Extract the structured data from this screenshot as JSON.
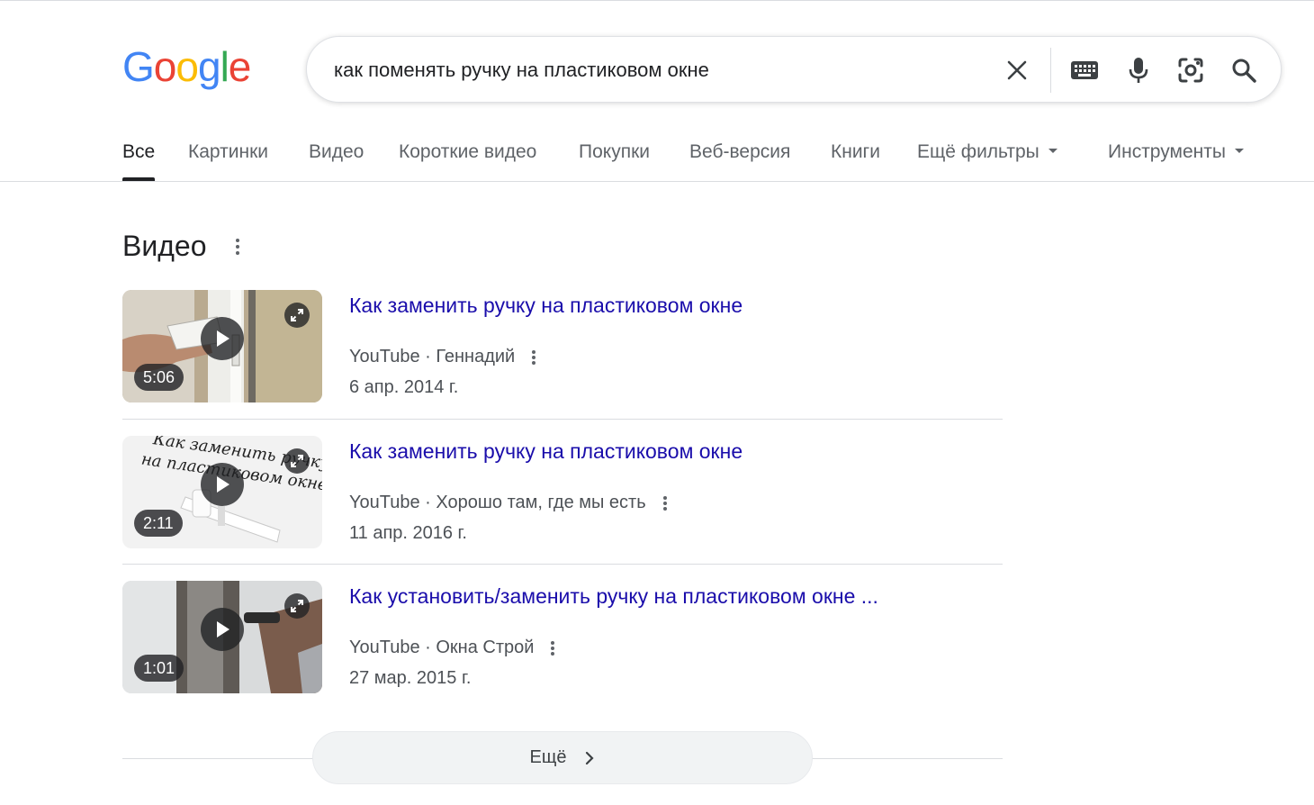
{
  "logo": {
    "text": "Google"
  },
  "search": {
    "query": "как поменять ручку на пластиковом окне"
  },
  "tabs": [
    {
      "label": "Все"
    },
    {
      "label": "Картинки"
    },
    {
      "label": "Видео"
    },
    {
      "label": "Короткие видео"
    },
    {
      "label": "Покупки"
    },
    {
      "label": "Веб-версия"
    },
    {
      "label": "Книги"
    },
    {
      "label": "Ещё фильтры"
    },
    {
      "label": "Инструменты"
    }
  ],
  "videos_section": {
    "title": "Видео",
    "items": [
      {
        "title": "Как заменить ручку на пластиковом окне",
        "source": "YouTube",
        "author": "Геннадий",
        "date": "6 апр. 2014 г.",
        "duration": "5:06"
      },
      {
        "title": "Как заменить ручку на пластиковом окне",
        "source": "YouTube",
        "author": "Хорошо там, где мы есть",
        "date": "11 апр. 2016 г.",
        "duration": "2:11",
        "thumb_text": [
          "Как заменить ручку",
          "на пластиковом окне"
        ]
      },
      {
        "title": "Как установить/заменить ручку на пластиковом окне ...",
        "source": "YouTube",
        "author": "Окна Строй",
        "date": "27 мар. 2015 г.",
        "duration": "1:01"
      }
    ],
    "separator": " · ",
    "more_label": "Ещё"
  },
  "icons": {
    "clear": "close-icon",
    "keyboard": "keyboard-icon",
    "voice": "mic-icon",
    "lens": "camera-lens-icon",
    "search": "search-icon",
    "menu": "more-vert-icon",
    "play": "play-icon",
    "expand": "expand-icon",
    "more_chevron": "chevron-right-icon"
  },
  "colors": {
    "link": "#1a0dab",
    "google_blue": "#4285F4",
    "google_red": "#EA4335",
    "google_yellow": "#FBBC05",
    "google_green": "#34A853"
  }
}
